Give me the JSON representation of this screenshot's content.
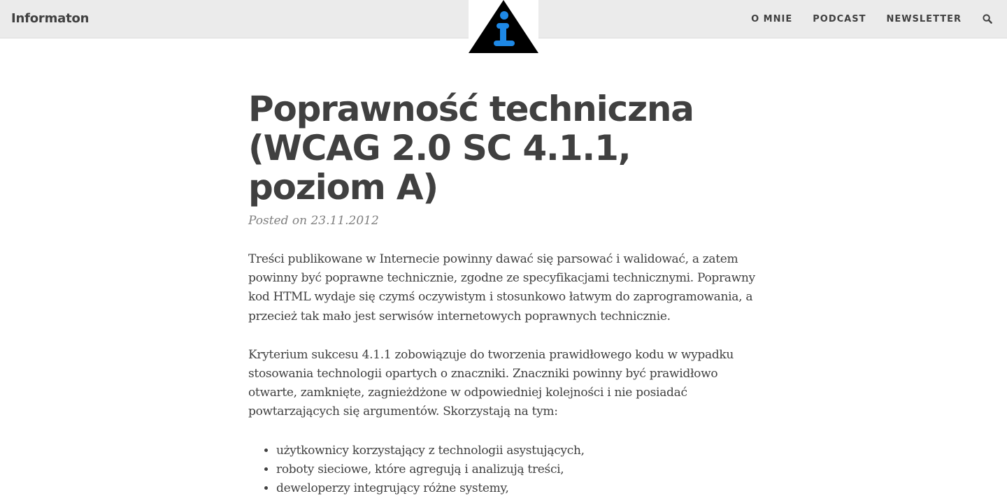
{
  "site": {
    "brand": "Informaton",
    "logo_icon": "info-triangle-logo-icon",
    "colors": {
      "logo_bg": "#000000",
      "logo_glyph": "#1e88e5",
      "navbar_bg": "#ebebeb"
    }
  },
  "nav": {
    "items": [
      {
        "label": "O MNIE"
      },
      {
        "label": "PODCAST"
      },
      {
        "label": "NEWSLETTER"
      }
    ],
    "search_icon": "search-icon"
  },
  "post": {
    "title": "Poprawność techniczna (WCAG 2.0 SC 4.1.1, poziom A)",
    "meta": "Posted on 23.11.2012",
    "paragraphs": [
      "Treści publikowane w Internecie powinny dawać się parsować i walidować, a zatem powinny być poprawne technicznie, zgodne ze specyfikacjami technicznymi. Poprawny kod HTML wydaje się czymś oczywistym i stosunkowo łatwym do zaprogramowania, a przecież tak mało jest serwisów internetowych poprawnych technicznie.",
      "Kryterium sukcesu 4.1.1 zobowiązuje do tworzenia prawidłowego kodu w wypadku stosowania technologii opartych o znaczniki. Znaczniki powinny być prawidłowo otwarte, zamknięte, zagnieżdżone w odpowiedniej kolejności i nie posiadać powtarzających się argumentów. Skorzystają na tym:"
    ],
    "list": [
      "użytkownicy korzystający z technologii asystujących,",
      "roboty sieciowe, które agregują i analizują treści,",
      "deweloperzy integrujący różne systemy,"
    ]
  }
}
